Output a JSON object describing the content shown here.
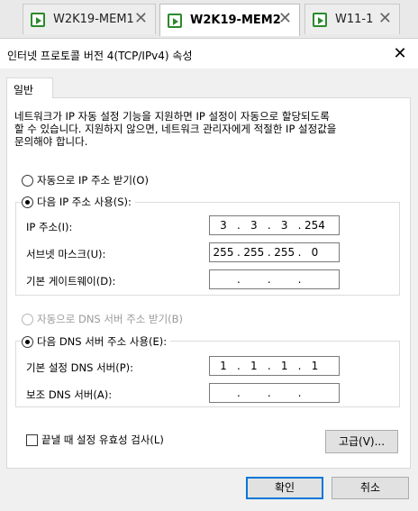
{
  "vm_tabs": [
    {
      "label": "W2K19-MEM1",
      "close": "✕"
    },
    {
      "label": "W2K19-MEM2",
      "close": "✕"
    },
    {
      "label": "W11-1",
      "close": "✕"
    }
  ],
  "dialog": {
    "title": "인터넷 프로토콜 버전 4(TCP/IPv4) 속성",
    "close": "✕",
    "tab_label": "일반",
    "description_line1": "네트워크가 IP 자동 설정 기능을 지원하면 IP 설정이 자동으로 할당되도록",
    "description_line2": "할 수 있습니다. 지원하지 않으면, 네트워크 관리자에게 적절한 IP 설정값을",
    "description_line3": "문의해야 합니다.",
    "auto_ip_label": "자동으로 IP 주소 받기(O)",
    "manual_ip_label": "다음 IP 주소 사용(S):",
    "ip_address_label": "IP 주소(I):",
    "ip_address": [
      "3",
      "3",
      "3",
      "254"
    ],
    "subnet_label": "서브넷 마스크(U):",
    "subnet": [
      "255",
      "255",
      "255",
      "0"
    ],
    "gateway_label": "기본 게이트웨이(D):",
    "gateway": [
      "",
      "",
      "",
      ""
    ],
    "auto_dns_label": "자동으로 DNS 서버 주소 받기(B)",
    "manual_dns_label": "다음 DNS 서버 주소 사용(E):",
    "preferred_dns_label": "기본 설정 DNS 서버(P):",
    "preferred_dns": [
      "1",
      "1",
      "1",
      "1"
    ],
    "alternate_dns_label": "보조 DNS 서버(A):",
    "alternate_dns": [
      "",
      "",
      "",
      ""
    ],
    "validate_label": "끝낼 때 설정 유효성 검사(L)",
    "advanced_label": "고급(V)...",
    "ok_label": "확인",
    "cancel_label": "취소"
  },
  "colors": {
    "accent": "#0078d7",
    "vm_icon": "#2b8a2b"
  }
}
